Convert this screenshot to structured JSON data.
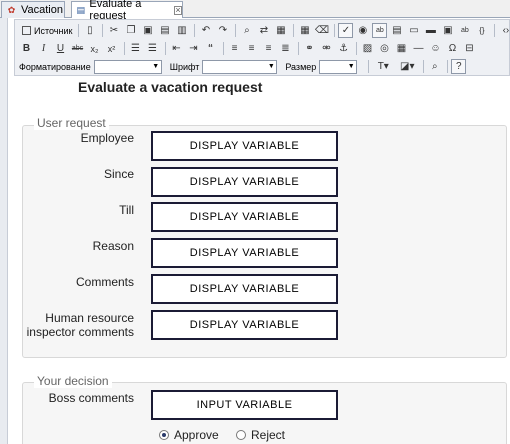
{
  "tabs": [
    {
      "label": "Vacation",
      "icon": "flow-icon",
      "active": false
    },
    {
      "label": "Evaluate a request",
      "icon": "form-icon",
      "active": true
    }
  ],
  "toolbar": {
    "source_label": "Источник",
    "format_label": "Форматирование",
    "font_label": "Шрифт",
    "size_label": "Размер"
  },
  "form": {
    "title": "Evaluate a vacation request",
    "user_request": {
      "legend": "User request",
      "fields": [
        {
          "label": "Employee",
          "value": "DISPLAY VARIABLE"
        },
        {
          "label": "Since",
          "value": "DISPLAY VARIABLE"
        },
        {
          "label": "Till",
          "value": "DISPLAY VARIABLE"
        },
        {
          "label": "Reason",
          "value": "DISPLAY VARIABLE"
        },
        {
          "label": "Comments",
          "value": "DISPLAY VARIABLE"
        },
        {
          "label": "Human resource inspector comments",
          "value": "DISPLAY VARIABLE"
        }
      ]
    },
    "decision": {
      "legend": "Your decision",
      "boss_label": "Boss comments",
      "boss_value": "INPUT VARIABLE",
      "options": [
        {
          "label": "Approve",
          "selected": true
        },
        {
          "label": "Reject",
          "selected": false
        }
      ]
    }
  }
}
